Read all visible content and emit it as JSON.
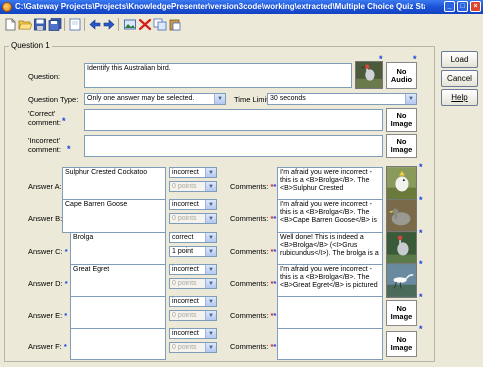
{
  "window": {
    "title": "C:\\Gateway Projects\\Projects\\KnowledgePresenter\\version3code\\working\\extracted\\Multiple Choice Quiz Standa...",
    "minimize_glyph": "_",
    "maximize_glyph": "□",
    "close_glyph": "×"
  },
  "toolbar": {
    "icons": [
      "new-file-icon",
      "open-folder-icon",
      "save-icon",
      "save-all-icon",
      "blank-page-icon",
      "previous-icon",
      "next-icon",
      "image-icon",
      "delete-icon",
      "copy-icon",
      "paste-icon"
    ]
  },
  "question": {
    "group_label": "Question 1",
    "question_label": "Question:",
    "question_text": "Identify this Australian bird.",
    "audio_button": "No\nAudio",
    "type_label": "Question Type:",
    "type_value": "Only one answer may be selected.",
    "time_limit_label": "Time Limit:",
    "time_limit_value": "30 seconds",
    "correct_label": "'Correct'\ncomment:",
    "incorrect_label": "'Incorrect'\ncomment:",
    "correct_comment": "",
    "incorrect_comment": "",
    "no_image_label": "No\nImage",
    "comments_label": "Comments:"
  },
  "answers": [
    {
      "label": "Answer A:",
      "text": "Sulphur Crested Cockatoo",
      "status": "incorrect",
      "points": "0 points",
      "comment": "I'm afraid you were incorrect - this is a <B>Brolga</B>. The <B>Sulphur Crested",
      "image": "cockatoo"
    },
    {
      "label": "Answer B:",
      "text": "Cape Barren Goose",
      "status": "incorrect",
      "points": "0 points",
      "comment": "I'm afraid you were incorrect - this is a <B>Brolga</B>. The <B>Cape Barren Goose</B> is",
      "image": "goose"
    },
    {
      "label": "Answer C:",
      "text": "Brolga",
      "status": "correct",
      "points": "1 point",
      "comment": "Well done! This is indeed a <B>Brolga</B> (<I>Grus rubicundus</I>). The brolga is a",
      "image": "brolga"
    },
    {
      "label": "Answer D:",
      "text": "Great Egret",
      "status": "incorrect",
      "points": "0 points",
      "comment": "I'm afraid you were incorrect - this is a <B>Brolga</B>. The <B>Great Egret</B> is pictured",
      "image": "egret"
    },
    {
      "label": "Answer E:",
      "text": "",
      "status": "incorrect",
      "points": "0 points",
      "comment": "",
      "image": ""
    },
    {
      "label": "Answer F:",
      "text": "",
      "status": "incorrect",
      "points": "0 points",
      "comment": "",
      "image": ""
    }
  ],
  "side": {
    "load": "Load",
    "cancel": "Cancel",
    "help": "Help"
  },
  "colors": {
    "title_bar": "#1c52d6",
    "required_blue": "#1040e0",
    "required_red": "#e02020"
  }
}
